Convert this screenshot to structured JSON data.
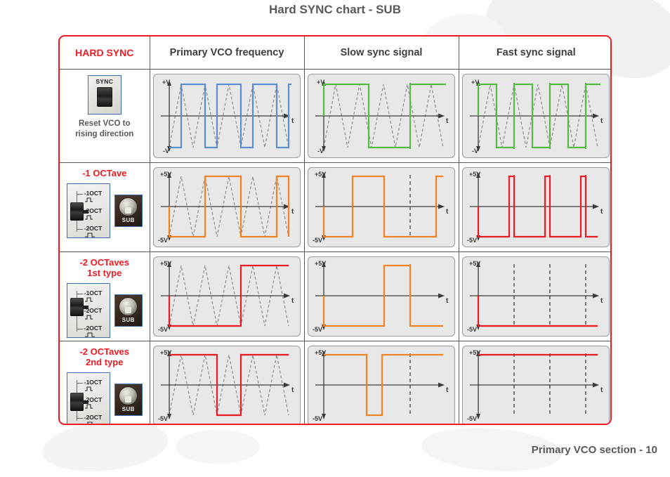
{
  "title": "Hard SYNC chart - SUB",
  "footer": "Primary VCO section - 10",
  "colors": {
    "accent_red": "#ed1c24",
    "text_grey": "#58595b",
    "wave_blue": "#5b8fd0",
    "wave_green": "#55bb44",
    "wave_orange": "#f58220",
    "wave_red": "#ed1c24",
    "reference_dash": "#8c8c8c",
    "plot_background": "#e8e8e8",
    "axis": "#3b3b3b"
  },
  "headers": {
    "corner": "HARD SYNC",
    "columns": [
      "Primary VCO frequency",
      "Slow sync signal",
      "Fast sync signal"
    ]
  },
  "rows": [
    {
      "title": "HARD SYNC",
      "caption": "Reset VCO to\nrising direction",
      "caption_line1": "Reset VCO to",
      "caption_line2": "rising direction",
      "control": {
        "kind": "sync-switch",
        "label": "SYNC"
      },
      "axis_labels": {
        "top": "+V",
        "bottom": "-V",
        "time": "t"
      }
    },
    {
      "title": "-1 OCTave",
      "control": {
        "kind": "octave-switch",
        "position": "middle",
        "options": [
          "-1OCT",
          "-2OCT",
          "-2OCT"
        ],
        "knob_label": "SUB"
      },
      "axis_labels": {
        "top": "+5V",
        "bottom": "-5V",
        "time": "t"
      }
    },
    {
      "title": "-2 OCTaves\n1st type",
      "title_line1": "-2 OCTaves",
      "title_line2": "1st type",
      "control": {
        "kind": "octave-switch",
        "position": "upper",
        "options": [
          "-1OCT",
          "-2OCT",
          "-2OCT"
        ],
        "knob_label": "SUB"
      },
      "axis_labels": {
        "top": "+5V",
        "bottom": "-5V",
        "time": "t"
      }
    },
    {
      "title": "-2 OCTaves\n2nd type",
      "title_line1": "-2 OCTaves",
      "title_line2": "2nd type",
      "control": {
        "kind": "octave-switch",
        "position": "lower",
        "options": [
          "-1OCT",
          "-2OCT",
          "-2OCT"
        ],
        "knob_label": "SUB"
      },
      "axis_labels": {
        "top": "+5V",
        "bottom": "-5V",
        "time": "t"
      }
    }
  ],
  "chart_data": {
    "type": "line",
    "description": "Oscilloscope-style waveform grid: 4 rows (sub-oscillator modes) x 3 columns (sync conditions). Each plot shows a square/pulse output wave plus a dashed grey triangle reference wave of the primary VCO.",
    "axis": {
      "x": "t",
      "y_top": "+5V",
      "y_bottom": "-5V",
      "y_top_row1": "+V",
      "y_bottom_row1": "-V"
    },
    "plots": [
      {
        "row": "HARD SYNC",
        "column": "Primary VCO frequency",
        "wave_color": "#5b8fd0",
        "reference": "triangle, 4 cycles, dashed grey",
        "square_cycles": 4,
        "levels": [
          -1,
          1,
          -1,
          1,
          -1,
          1,
          -1,
          1,
          -1
        ],
        "sync_markers": []
      },
      {
        "row": "HARD SYNC",
        "column": "Slow sync signal",
        "wave_color": "#55bb44",
        "reference": "triangle, 4 cycles, dashed grey",
        "square_cycles": 1.5,
        "levels": [
          1,
          -1,
          1
        ],
        "sync_markers": [
          0.75
        ]
      },
      {
        "row": "HARD SYNC",
        "column": "Fast sync signal",
        "wave_color": "#55bb44",
        "reference": "triangle, 4 cycles, dashed grey",
        "square_cycles": 3.5,
        "levels": [
          1,
          -1,
          1,
          -1,
          1,
          -1,
          1
        ],
        "sync_markers": [
          0.3,
          0.55,
          0.83
        ]
      },
      {
        "row": "-1 OCTave",
        "column": "Primary VCO frequency",
        "wave_color": "#f58220",
        "reference": "triangle, 4 cycles, dashed grey",
        "square_cycles": 2,
        "levels": [
          -1,
          1,
          -1,
          1
        ],
        "sync_markers": []
      },
      {
        "row": "-1 OCTave",
        "column": "Slow sync signal",
        "wave_color": "#f58220",
        "reference": "none",
        "square_cycles": 1.5,
        "levels": [
          -1,
          1,
          -1,
          1
        ],
        "sync_markers": [
          0.72
        ]
      },
      {
        "row": "-1 OCTave",
        "column": "Fast sync signal",
        "wave_color": "#ed1c24",
        "reference": "none",
        "pulse_count": 3,
        "levels": [
          -1,
          1,
          -1,
          1,
          -1,
          1,
          -1
        ],
        "sync_markers": [
          0.3,
          0.55,
          0.83
        ]
      },
      {
        "row": "-2 OCTaves 1st type",
        "column": "Primary VCO frequency",
        "wave_color": "#ed1c24",
        "reference": "triangle, 4 cycles, dashed grey",
        "square_cycles": 1,
        "levels": [
          -1,
          1
        ],
        "sync_markers": []
      },
      {
        "row": "-2 OCTaves 1st type",
        "column": "Slow sync signal",
        "wave_color": "#f58220",
        "reference": "none",
        "square_cycles": 1,
        "levels": [
          -1,
          1,
          -1
        ],
        "sync_markers": [
          0.72
        ]
      },
      {
        "row": "-2 OCTaves 1st type",
        "column": "Fast sync signal",
        "wave_color": "#ed1c24",
        "reference": "none",
        "square_cycles": 0,
        "levels": [
          -1
        ],
        "sync_markers": [
          0.3,
          0.55,
          0.83
        ]
      },
      {
        "row": "-2 OCTaves 2nd type",
        "column": "Primary VCO frequency",
        "wave_color": "#ed1c24",
        "reference": "triangle, 4 cycles, dashed grey",
        "square_cycles": 1,
        "levels": [
          1,
          -1,
          1
        ],
        "sync_markers": []
      },
      {
        "row": "-2 OCTaves 2nd type",
        "column": "Slow sync signal",
        "wave_color": "#f58220",
        "reference": "none",
        "square_cycles": 1,
        "levels": [
          1,
          -1,
          1
        ],
        "sync_markers": [
          0.72
        ]
      },
      {
        "row": "-2 OCTaves 2nd type",
        "column": "Fast sync signal",
        "wave_color": "#ed1c24",
        "reference": "none",
        "square_cycles": 0,
        "levels": [
          1
        ],
        "sync_markers": [
          0.3,
          0.55,
          0.83
        ]
      }
    ]
  }
}
